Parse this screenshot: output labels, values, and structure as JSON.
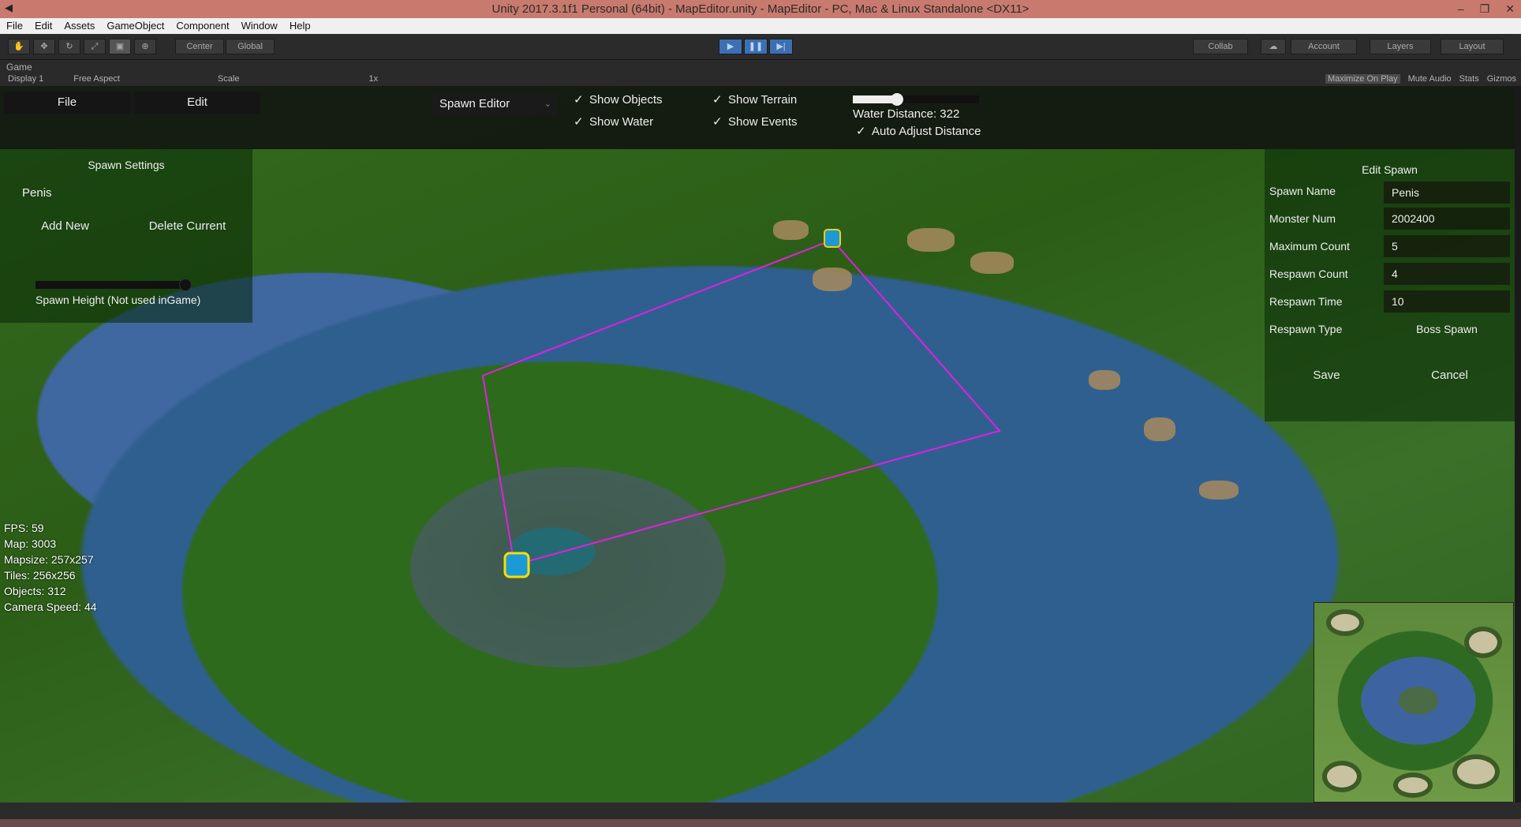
{
  "window": {
    "title": "Unity 2017.3.1f1 Personal (64bit) - MapEditor.unity - MapEditor - PC, Mac & Linux Standalone <DX11>",
    "minimize": "–",
    "maximize": "❐",
    "close": "✕"
  },
  "menu": [
    "File",
    "Edit",
    "Assets",
    "GameObject",
    "Component",
    "Window",
    "Help"
  ],
  "toolbar": {
    "pivot": "Center",
    "space": "Global",
    "collab": "Collab",
    "account": "Account",
    "layers": "Layers",
    "layout": "Layout"
  },
  "gameview": {
    "tab": "Game",
    "display": "Display 1",
    "aspect": "Free Aspect",
    "scale_label": "Scale",
    "scale_value": "1x",
    "right_buttons": [
      "Maximize On Play",
      "Mute Audio",
      "Stats",
      "Gizmos"
    ]
  },
  "game_ui": {
    "file_button": "File",
    "edit_button": "Edit",
    "mode_dropdown": "Spawn Editor",
    "checks": [
      {
        "label": "Show Objects",
        "checked": true
      },
      {
        "label": "Show Water",
        "checked": true
      },
      {
        "label": "Show Terrain",
        "checked": true
      },
      {
        "label": "Show Events",
        "checked": true
      }
    ],
    "water_distance_label": "Water Distance: 322",
    "water_distance_fraction": 0.35,
    "auto_adjust_label": "Auto Adjust Distance",
    "auto_adjust_checked": true
  },
  "spawn_settings": {
    "title": "Spawn Settings",
    "selected": "Penis",
    "add_new": "Add New",
    "delete_current": "Delete Current",
    "height_label": "Spawn Height (Not used inGame)",
    "height_fraction": 1.0
  },
  "edit_spawn": {
    "title": "Edit Spawn",
    "fields": [
      {
        "label": "Spawn Name",
        "value": "Penis"
      },
      {
        "label": "Monster Num",
        "value": "2002400"
      },
      {
        "label": "Maximum Count",
        "value": "5"
      },
      {
        "label": "Respawn Count",
        "value": "4"
      },
      {
        "label": "Respawn Time",
        "value": "10"
      }
    ],
    "respawn_type_label": "Respawn Type",
    "respawn_type_value": "Boss Spawn",
    "save": "Save",
    "cancel": "Cancel"
  },
  "stats": [
    "FPS: 59",
    "Map: 3003",
    "Mapsize: 257x257",
    "Tiles: 256x256",
    "Objects: 312",
    "Camera Speed: 44"
  ],
  "colors": {
    "spawn_outline": "#e020e0",
    "title_bar": "#c87a6e"
  }
}
